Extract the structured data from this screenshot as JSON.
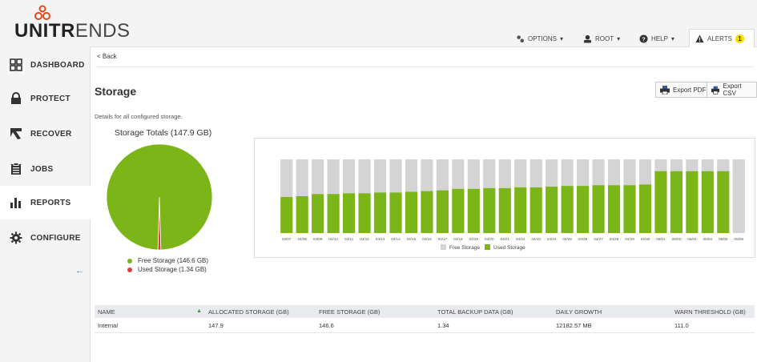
{
  "brand": {
    "name_bold": "UNITR",
    "name_thin": "ENDS"
  },
  "topnav": {
    "options": "OPTIONS",
    "root": "ROOT",
    "help": "HELP",
    "alerts": "ALERTS",
    "alerts_count": "1"
  },
  "sidebar": {
    "items": [
      {
        "label": "DASHBOARD",
        "icon": "grid-icon"
      },
      {
        "label": "PROTECT",
        "icon": "lock-icon"
      },
      {
        "label": "RECOVER",
        "icon": "recover-arrow-icon"
      },
      {
        "label": "JOBS",
        "icon": "clipboard-icon"
      },
      {
        "label": "REPORTS",
        "icon": "bar-chart-icon",
        "active": true
      },
      {
        "label": "CONFIGURE",
        "icon": "gear-icon"
      }
    ],
    "collapse": "←"
  },
  "main": {
    "back": "< Back",
    "title": "Storage",
    "subtitle": "Details for all configured storage.",
    "export_pdf": "Export PDF",
    "export_csv": "Export CSV"
  },
  "pie": {
    "title": "Storage Totals (147.9 GB)",
    "legend": [
      {
        "label": "Free Storage (146.6 GB)",
        "color": "#7cb518"
      },
      {
        "label": "Used Storage (1.34 GB)",
        "color": "#e23b3b"
      }
    ]
  },
  "chart_data": [
    {
      "type": "pie",
      "title": "Storage Totals (147.9 GB)",
      "categories": [
        "Free Storage (146.6 GB)",
        "Used Storage (1.34 GB)"
      ],
      "values": [
        146.6,
        1.34
      ],
      "colors": [
        "#7cb518",
        "#e23b3b"
      ]
    },
    {
      "type": "bar",
      "stacked": true,
      "categories": [
        "04/07",
        "04/08",
        "04/09",
        "04/10",
        "04/11",
        "04/12",
        "04/13",
        "04/14",
        "04/15",
        "04/16",
        "04/17",
        "04/18",
        "04/19",
        "04/20",
        "04/21",
        "04/22",
        "04/23",
        "04/24",
        "04/25",
        "04/26",
        "04/27",
        "04/28",
        "04/29",
        "04/30",
        "05/01",
        "05/02",
        "05/03",
        "05/04",
        "05/05",
        "05/06"
      ],
      "series": [
        {
          "name": "Used Storage",
          "color": "#7cb518",
          "values": [
            0.49,
            0.5,
            0.53,
            0.53,
            0.54,
            0.54,
            0.55,
            0.55,
            0.56,
            0.57,
            0.58,
            0.6,
            0.6,
            0.61,
            0.61,
            0.62,
            0.62,
            0.63,
            0.64,
            0.64,
            0.65,
            0.65,
            0.65,
            0.66,
            0.84,
            0.84,
            0.84,
            0.84,
            0.84,
            0.0
          ]
        },
        {
          "name": "Free Storage",
          "color": "#d4d4d4",
          "values": [
            0.51,
            0.5,
            0.47,
            0.47,
            0.46,
            0.46,
            0.45,
            0.45,
            0.44,
            0.43,
            0.42,
            0.4,
            0.4,
            0.39,
            0.39,
            0.38,
            0.38,
            0.37,
            0.36,
            0.36,
            0.35,
            0.35,
            0.35,
            0.34,
            0.16,
            0.16,
            0.16,
            0.16,
            0.16,
            1.0
          ]
        }
      ],
      "legend": "bottom",
      "grid": false
    }
  ],
  "table": {
    "columns": [
      "NAME",
      "ALLOCATED STORAGE (GB)",
      "FREE STORAGE (GB)",
      "TOTAL BACKUP DATA (GB)",
      "DAILY GROWTH",
      "WARN THRESHOLD (GB)"
    ],
    "rows": [
      [
        "Internal",
        "147.9",
        "146.6",
        "1.34",
        "12182.57 MB",
        "111.0"
      ]
    ]
  }
}
